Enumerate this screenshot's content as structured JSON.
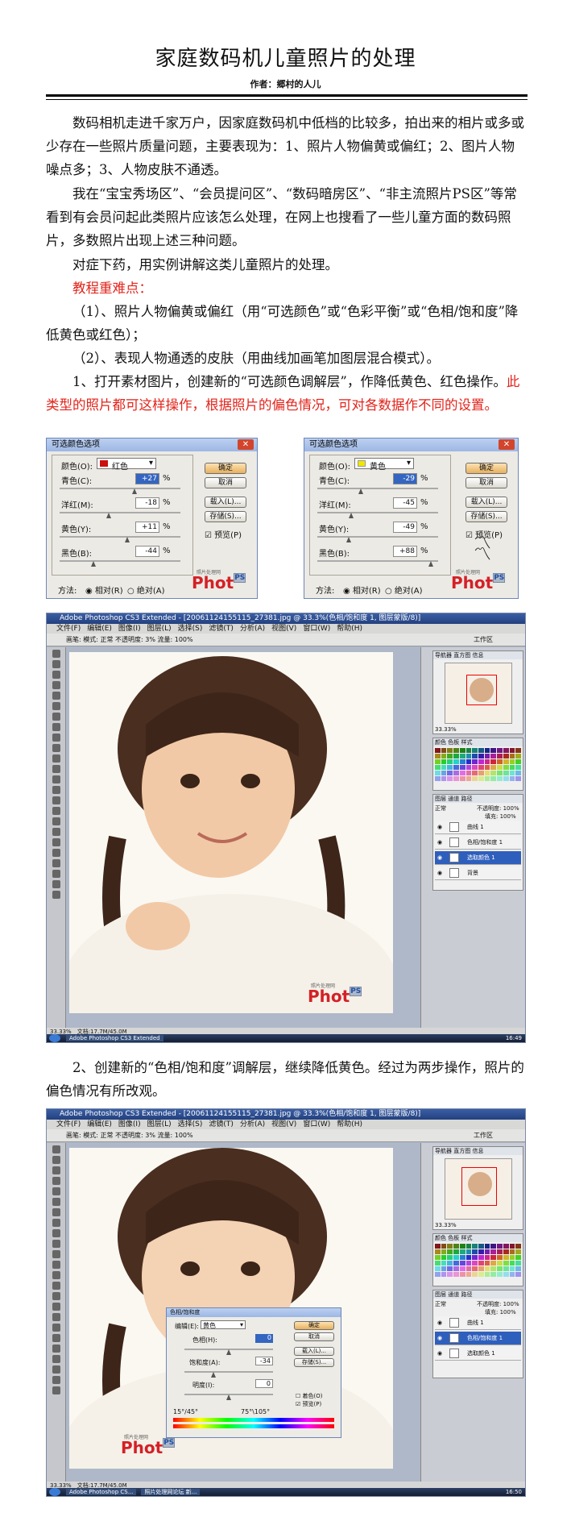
{
  "title": "家庭数码机儿童照片的处理",
  "author": "作者：郷村的人儿",
  "paragraphs": {
    "p1": "数码相机走进千家万户，因家庭数码机中低档的比较多，拍出来的相片或多或少存在一些照片质量问题，主要表现为：1、照片人物偏黄或偏红；2、图片人物噪点多；3、人物皮肤不通透。",
    "p2": "我在“宝宝秀场区”、“会员提问区”、“数码暗房区”、“非主流照片PS区”等常看到有会员问起此类照片应该怎么处理，在网上也搜看了一些儿童方面的数码照片，多数照片出现上述三种问题。",
    "p3": "对症下药，用实例讲解这类儿童照片的处理。",
    "p4": "教程重难点：",
    "p5": "（1）、照片人物偏黄或偏红（用“可选颜色”或“色彩平衡”或“色相/饱和度”降低黄色或红色）；",
    "p6": "（2）、表现人物通透的皮肤（用曲线加画笔加图层混合模式）。",
    "p7_black": "1、打开素材图片，创建新的“可选颜色调解层”，作降低黄色、红色操作。",
    "p7_red": "此类型的照片都可这样操作，根据照片的偏色情况，可对各数据作不同的设置。",
    "p8": "2、创建新的“色相/饱和度”调解层，继续降低黄色。经过为两步操作，照片的偏色情况有所改观。"
  },
  "selective_color_dialogs": [
    {
      "title": "可选颜色选项",
      "color_label": "颜色(O):",
      "color_value": "红色",
      "swatch": "#cc1010",
      "rows": [
        {
          "label": "青色(C):",
          "value": "+27",
          "frac": 0.62
        },
        {
          "label": "洋红(M):",
          "value": "-18",
          "frac": 0.41
        },
        {
          "label": "黄色(Y):",
          "value": "+11",
          "frac": 0.56
        },
        {
          "label": "黑色(B):",
          "value": "-44",
          "frac": 0.28
        }
      ]
    },
    {
      "title": "可选颜色选项",
      "color_label": "颜色(O):",
      "color_value": "黄色",
      "swatch": "#f0e800",
      "rows": [
        {
          "label": "青色(C):",
          "value": "-29",
          "frac": 0.36
        },
        {
          "label": "洋红(M):",
          "value": "-45",
          "frac": 0.28
        },
        {
          "label": "黄色(Y):",
          "value": "-49",
          "frac": 0.26
        },
        {
          "label": "黑色(B):",
          "value": "+88",
          "frac": 0.94
        }
      ]
    }
  ],
  "dialog_common": {
    "unit": "%",
    "ok": "确定",
    "cancel": "取消",
    "load": "载入(L)...",
    "save": "存储(S)...",
    "preview": "预览(P)",
    "method_label": "方法:",
    "relative": "相对(R)",
    "absolute": "绝对(A)",
    "logo_a": "Phot",
    "logo_b": "PS",
    "logo_sub": "照片处理网"
  },
  "photoshop": {
    "window_title_1": "Adobe Photoshop CS3 Extended - [20061124155115_27381.jpg @ 33.3%(色相/饱和度 1, 图层蒙版/8)]",
    "window_title_2": "Adobe Photoshop CS3 Extended - [20061124155115_27381.jpg @ 33.3%(色相/饱和度 1, 图层蒙版/8)]",
    "menu": [
      "文件(F)",
      "编辑(E)",
      "图像(I)",
      "图层(L)",
      "选择(S)",
      "滤镜(T)",
      "分析(A)",
      "视图(V)",
      "窗口(W)",
      "帮助(H)"
    ],
    "options": "画笔: 模式: 正常 不透明度: 3% 流量: 100%",
    "workspace": "工作区",
    "nav_tabs": "导航器 直方图 信息",
    "zoom": "33.33%",
    "swatch_tabs": "颜色 色板 样式",
    "layers_tabs": "图层 通道 路径",
    "blend": "正常",
    "opacity": "不透明度: 100%",
    "fill": "填充: 100%",
    "layers_1": [
      "曲线 1",
      "色相/饱和度 1",
      "选取颜色 1",
      "背景"
    ],
    "layers_2": [
      "曲线 1",
      "色相/饱和度 1",
      "选取颜色 1"
    ],
    "doc_size": "文档:17.7M/45.0M",
    "status_zoom": "33.33%",
    "task_ps": "Adobe Photoshop CS3 Extended",
    "task_ps2": "Adobe Photoshop CS...",
    "task_web": "照片处理网论坛 新...",
    "clock_1": "16:49",
    "clock_2": "16:50"
  },
  "hue_sat": {
    "title": "色相/饱和度",
    "edit_label": "编辑(E):",
    "edit_value": "黄色",
    "hue_label": "色相(H):",
    "hue_value": "0",
    "sat_label": "饱和度(A):",
    "sat_value": "-34",
    "light_label": "明度(I):",
    "light_value": "0",
    "range_left": "15°/45°",
    "range_right": "75°\\105°",
    "colorize": "着色(O)",
    "preview": "预览(P)",
    "ok": "确定",
    "cancel": "取消",
    "load": "载入(L)...",
    "save": "存储(S)..."
  }
}
